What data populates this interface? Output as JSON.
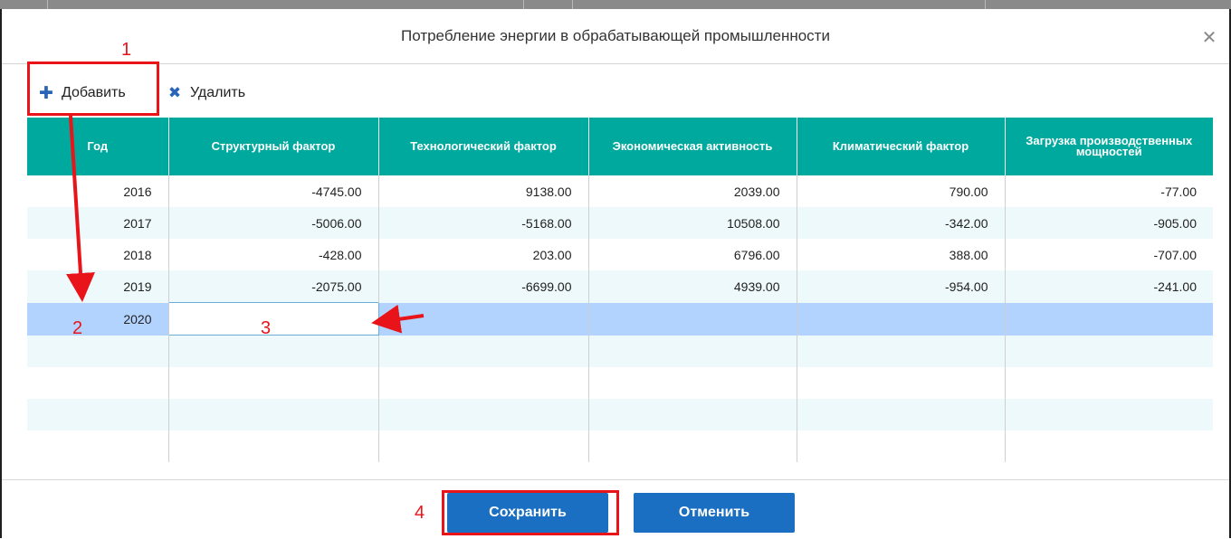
{
  "dialog": {
    "title": "Потребление энергии в обрабатывающей промышленности",
    "close_icon": "close-icon"
  },
  "toolbar": {
    "add_label": "Добавить",
    "add_icon": "plus-icon",
    "delete_label": "Удалить",
    "delete_icon": "x-icon"
  },
  "table": {
    "columns": [
      "Год",
      "Структурный фактор",
      "Технологический фактор",
      "Экономическая активность",
      "Климатический фактор",
      "Загрузка производственных мощностей"
    ],
    "rows": [
      [
        "2016",
        "-4745.00",
        "9138.00",
        "2039.00",
        "790.00",
        "-77.00"
      ],
      [
        "2017",
        "-5006.00",
        "-5168.00",
        "10508.00",
        "-342.00",
        "-905.00"
      ],
      [
        "2018",
        "-428.00",
        "203.00",
        "6796.00",
        "388.00",
        "-707.00"
      ],
      [
        "2019",
        "-2075.00",
        "-6699.00",
        "4939.00",
        "-954.00",
        "-241.00"
      ],
      [
        "2020",
        "",
        "",
        "",
        "",
        ""
      ]
    ],
    "selected_row": 4
  },
  "footer": {
    "save_label": "Сохранить",
    "cancel_label": "Отменить"
  },
  "annotations": {
    "n1": "1",
    "n2": "2",
    "n3": "3",
    "n4": "4",
    "color": "#e8141a"
  },
  "colors": {
    "header_bg": "#00a99d",
    "button_bg": "#1a6fc2",
    "selected_row_bg": "#b3d3ff",
    "alt_row_bg": "#eef9fb"
  }
}
